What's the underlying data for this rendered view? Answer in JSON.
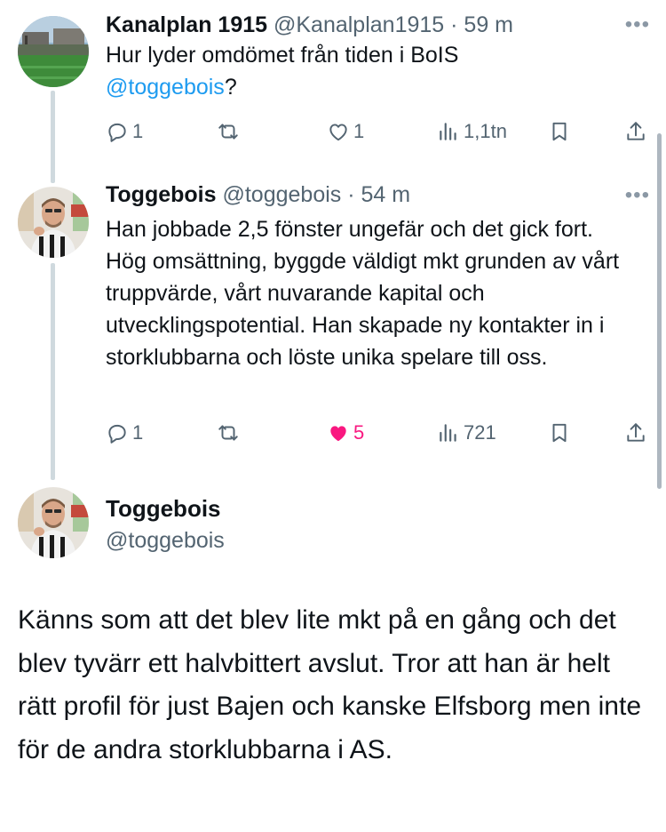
{
  "tweets": [
    {
      "name": "Kanalplan 1915",
      "handle": "@Kanalplan1915",
      "separator": "·",
      "time": "59 m",
      "text_before": "Hur lyder omdömet från tiden i BoIS",
      "mention": "@toggebois",
      "text_after": "?",
      "replies": "1",
      "retweets": "",
      "likes": "1",
      "views": "1,1tn",
      "liked": false,
      "avatar": "stadium-photo"
    },
    {
      "name": "Toggebois",
      "handle": "@toggebois",
      "separator": "·",
      "time": "54 m",
      "text": "Han jobbade 2,5 fönster ungefär och det gick fort. Hög omsättning, byggde väldigt mkt grunden av vårt truppvärde, vårt nuvarande kapital och utvecklingspotential. Han skapade ny kontakter in i storklubbarna och löste unika spelare till oss.",
      "replies": "1",
      "retweets": "",
      "likes": "5",
      "views": "721",
      "liked": true,
      "avatar": "man-portrait"
    }
  ],
  "main_tweet": {
    "name": "Toggebois",
    "handle": "@toggebois",
    "text": "Känns som att det blev lite mkt på en gång och det blev tyvärr ett halvbittert avslut. Tror att han är helt rätt profil för just Bajen och kanske Elfsborg men inte för de andra storklubbarna i AS."
  },
  "more_label": "•••",
  "colors": {
    "mention": "#1d9bf0",
    "like_active": "#f91880",
    "secondary_text": "#536471",
    "thread_line": "#cfd9de"
  },
  "icons": [
    "reply-icon",
    "retweet-icon",
    "like-icon",
    "views-icon",
    "bookmark-icon",
    "share-icon",
    "more-icon"
  ]
}
